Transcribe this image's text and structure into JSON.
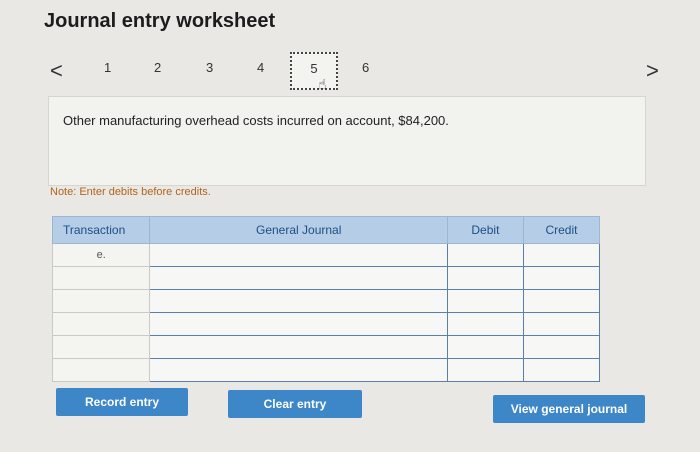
{
  "title": "Journal entry worksheet",
  "nav": {
    "prev": "<",
    "next": ">",
    "pages": [
      "1",
      "2",
      "3",
      "4",
      "5",
      "6"
    ],
    "active_page": "5"
  },
  "description": "Other manufacturing overhead costs incurred on account, $84,200.",
  "note": "Note: Enter debits before credits.",
  "table": {
    "headers": [
      "Transaction",
      "General Journal",
      "Debit",
      "Credit"
    ],
    "rows": [
      {
        "transaction": "e.",
        "account": "",
        "debit": "",
        "credit": ""
      },
      {
        "transaction": "",
        "account": "",
        "debit": "",
        "credit": ""
      },
      {
        "transaction": "",
        "account": "",
        "debit": "",
        "credit": ""
      },
      {
        "transaction": "",
        "account": "",
        "debit": "",
        "credit": ""
      },
      {
        "transaction": "",
        "account": "",
        "debit": "",
        "credit": ""
      },
      {
        "transaction": "",
        "account": "",
        "debit": "",
        "credit": ""
      }
    ]
  },
  "buttons": {
    "record": "Record entry",
    "clear": "Clear entry",
    "view": "View general journal"
  }
}
